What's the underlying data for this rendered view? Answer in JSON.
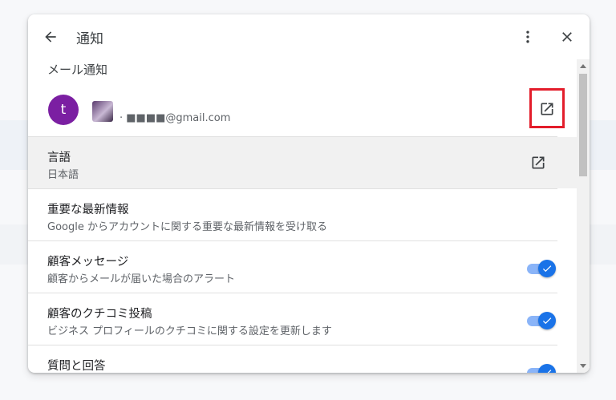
{
  "header": {
    "title": "通知",
    "back_icon": "arrow-back-icon",
    "more_icon": "more-vert-icon",
    "close_icon": "close-icon"
  },
  "section_label": "メール通知",
  "account": {
    "avatar_letter": "t",
    "avatar_color": "#7b1fa2",
    "email": "· ■■■■@gmail.com",
    "open_icon": "open-in-new-icon"
  },
  "language": {
    "title": "言語",
    "value": "日本語",
    "open_icon": "open-in-new-icon"
  },
  "settings": [
    {
      "title": "重要な最新情報",
      "subtitle": "Google からアカウントに関する重要な最新情報を受け取る",
      "toggle": null
    },
    {
      "title": "顧客メッセージ",
      "subtitle": "顧客からメールが届いた場合のアラート",
      "toggle": true
    },
    {
      "title": "顧客のクチコミ投稿",
      "subtitle": "ビジネス プロフィールのクチコミに関する設定を更新します",
      "toggle": true
    },
    {
      "title": "質問と回答",
      "subtitle": "",
      "toggle": true
    }
  ],
  "colors": {
    "accent": "#1a73e8",
    "highlight": "#e31d2b"
  }
}
